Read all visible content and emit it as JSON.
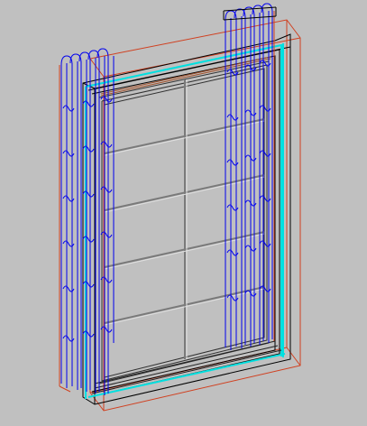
{
  "viewport": {
    "background": "#c0c0c0"
  },
  "palette": {
    "frame_black": "#000000",
    "glass_cyan": "#00ffff",
    "curtain_blue": "#0000ff",
    "bounding_red": "#ff0000",
    "mullion_gray": "#808080",
    "sill_brown": "#a0522d"
  },
  "drawing": {
    "grid_rows": 5,
    "grid_cols": 2,
    "curtain_left_folds": 5,
    "curtain_right_folds": 5
  }
}
